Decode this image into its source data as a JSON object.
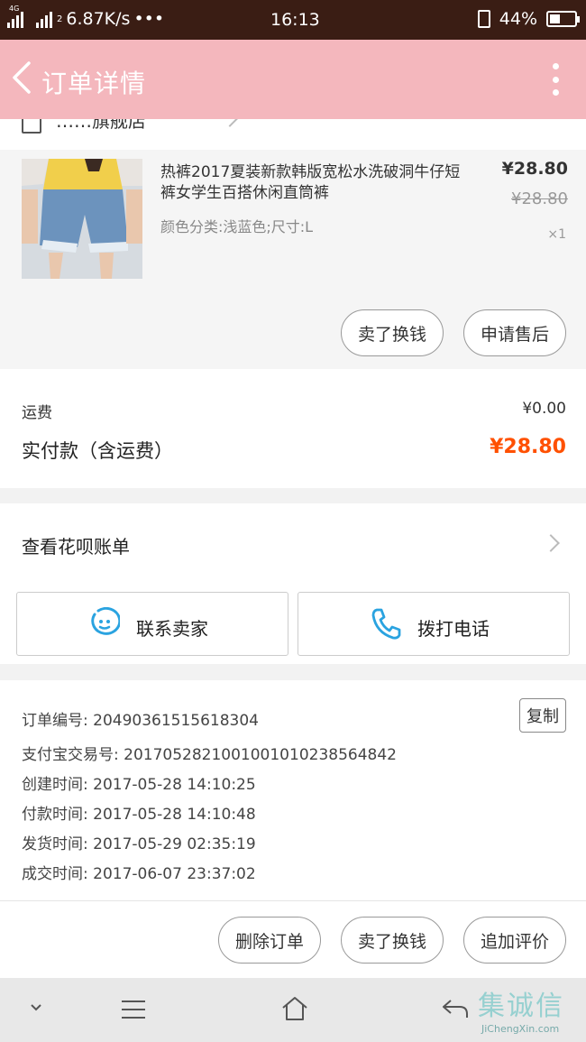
{
  "status_bar": {
    "network_type": "4G",
    "sim_indicator": "2",
    "speed": "6.87K/s",
    "dots": "•••",
    "time": "16:13",
    "battery": "44%",
    "battery_level": 0.44
  },
  "header": {
    "title": "订单详情"
  },
  "shop": {
    "name": "……旗舰店"
  },
  "product": {
    "title": "热裤2017夏装新款韩版宽松水洗破洞牛仔短裤女学生百搭休闲直筒裤",
    "sku": "颜色分类:浅蓝色;尺寸:L",
    "price": "¥28.80",
    "original_price": "¥28.80",
    "quantity": "×1",
    "btn_resell": "卖了换钱",
    "btn_after_sale": "申请售后"
  },
  "fees": {
    "shipping_label": "运费",
    "shipping_value": "¥0.00",
    "paid_label": "实付款（含运费）",
    "paid_value": "¥28.80"
  },
  "bill": {
    "label": "查看花呗账单"
  },
  "contact": {
    "seller_label": "联系卖家",
    "call_label": "拨打电话"
  },
  "order_info": {
    "rows": [
      "订单编号: 20490361515618304",
      "支付宝交易号: 2017052821001001010238564842",
      "创建时间: 2017-05-28 14:10:25",
      "付款时间: 2017-05-28 14:10:48",
      "发货时间: 2017-05-29 02:35:19",
      "成交时间: 2017-06-07 23:37:02"
    ],
    "copy_label": "复制"
  },
  "actions": {
    "delete": "删除订单",
    "resell": "卖了换钱",
    "review": "追加评价"
  },
  "watermark": {
    "text_cn": "集诚信",
    "text_en": "JiChengXin.com"
  },
  "colors": {
    "header_bg": "#f4b7bd",
    "status_bg": "#3a1d14",
    "price_accent": "#ff5000",
    "icon_blue": "#2aa3e0"
  },
  "icons": [
    "back-icon",
    "more-icon",
    "shop-icon",
    "chat-icon",
    "phone-icon",
    "chevron-right-icon",
    "chevron-down-icon",
    "menu-icon",
    "home-icon",
    "return-icon"
  ]
}
